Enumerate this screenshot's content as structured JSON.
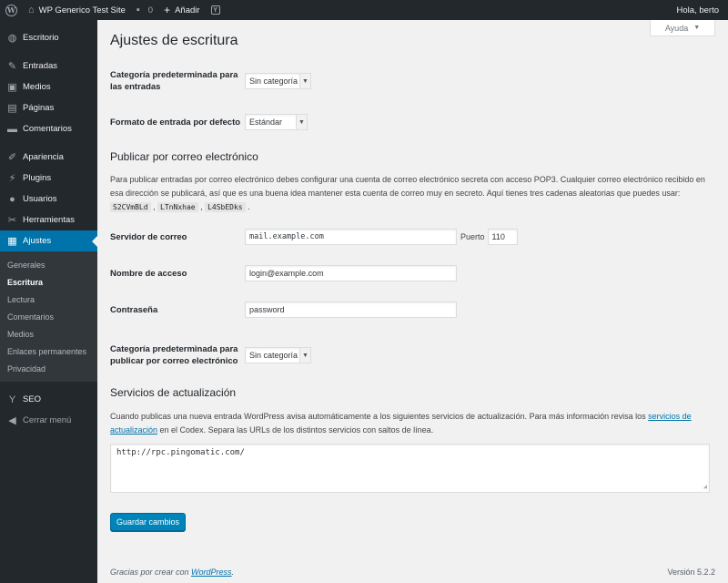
{
  "adminbar": {
    "site_name": "WP Generico Test Site",
    "comments_count": "0",
    "new_label": "Añadir",
    "greeting": "Hola, berto"
  },
  "sidebar": {
    "items": [
      {
        "label": "Escritorio",
        "icon": "dashboard-icon"
      },
      {
        "label": "Entradas",
        "icon": "pin-icon"
      },
      {
        "label": "Medios",
        "icon": "media-icon"
      },
      {
        "label": "Páginas",
        "icon": "pages-icon"
      },
      {
        "label": "Comentarios",
        "icon": "comments-icon"
      },
      {
        "label": "Apariencia",
        "icon": "appearance-icon"
      },
      {
        "label": "Plugins",
        "icon": "plugins-icon"
      },
      {
        "label": "Usuarios",
        "icon": "users-icon"
      },
      {
        "label": "Herramientas",
        "icon": "tools-icon"
      },
      {
        "label": "Ajustes",
        "icon": "settings-icon"
      },
      {
        "label": "SEO",
        "icon": "yoast-icon"
      },
      {
        "label": "Cerrar menú",
        "icon": "collapse-icon"
      }
    ],
    "submenu": [
      "Generales",
      "Escritura",
      "Lectura",
      "Comentarios",
      "Medios",
      "Enlaces permanentes",
      "Privacidad"
    ],
    "current_submenu": "Escritura"
  },
  "help_label": "Ayuda",
  "page_title": "Ajustes de escritura",
  "fields": {
    "default_category_label": "Categoría predeterminada para las entradas",
    "default_category_value": "Sin categoría",
    "default_format_label": "Formato de entrada por defecto",
    "default_format_value": "Estándar",
    "mail_server_label": "Servidor de correo",
    "mail_server_value": "mail.example.com",
    "port_label": "Puerto",
    "port_value": "110",
    "login_label": "Nombre de acceso",
    "login_value": "login@example.com",
    "password_label": "Contraseña",
    "password_value": "password",
    "mail_category_label": "Categoría predeterminada para publicar por correo electrónico",
    "mail_category_value": "Sin categoría"
  },
  "post_via_email": {
    "heading": "Publicar por correo electrónico",
    "text_before": "Para publicar entradas por correo electrónico debes configurar una cuenta de correo electrónico secreta con acceso POP3. Cualquier correo electrónico recibido en esa dirección se publicará, así que es una buena idea mantener esta cuenta de correo muy en secreto. Aquí tienes tres cadenas aleatorias que puedes usar: ",
    "codes": [
      "S2CVmBLd",
      "LTnNxhae",
      "L4SbEDks"
    ]
  },
  "update_services": {
    "heading": "Servicios de actualización",
    "text_before": "Cuando publicas una nueva entrada WordPress avisa automáticamente a los siguientes servicios de actualización. Para más información revisa los ",
    "link_text": "servicios de actualización",
    "text_after": " en el Codex. Separa las URLs de los distintos servicios con saltos de línea.",
    "textarea_value": "http://rpc.pingomatic.com/"
  },
  "save_label": "Guardar cambios",
  "footer": {
    "thanks_before": "Gracias por crear con ",
    "thanks_link": "WordPress",
    "thanks_after": ".",
    "version": "Versión 5.2.2"
  },
  "colors": {
    "accent": "#0073aa",
    "sidebar": "#23282d",
    "button": "#0085ba"
  }
}
